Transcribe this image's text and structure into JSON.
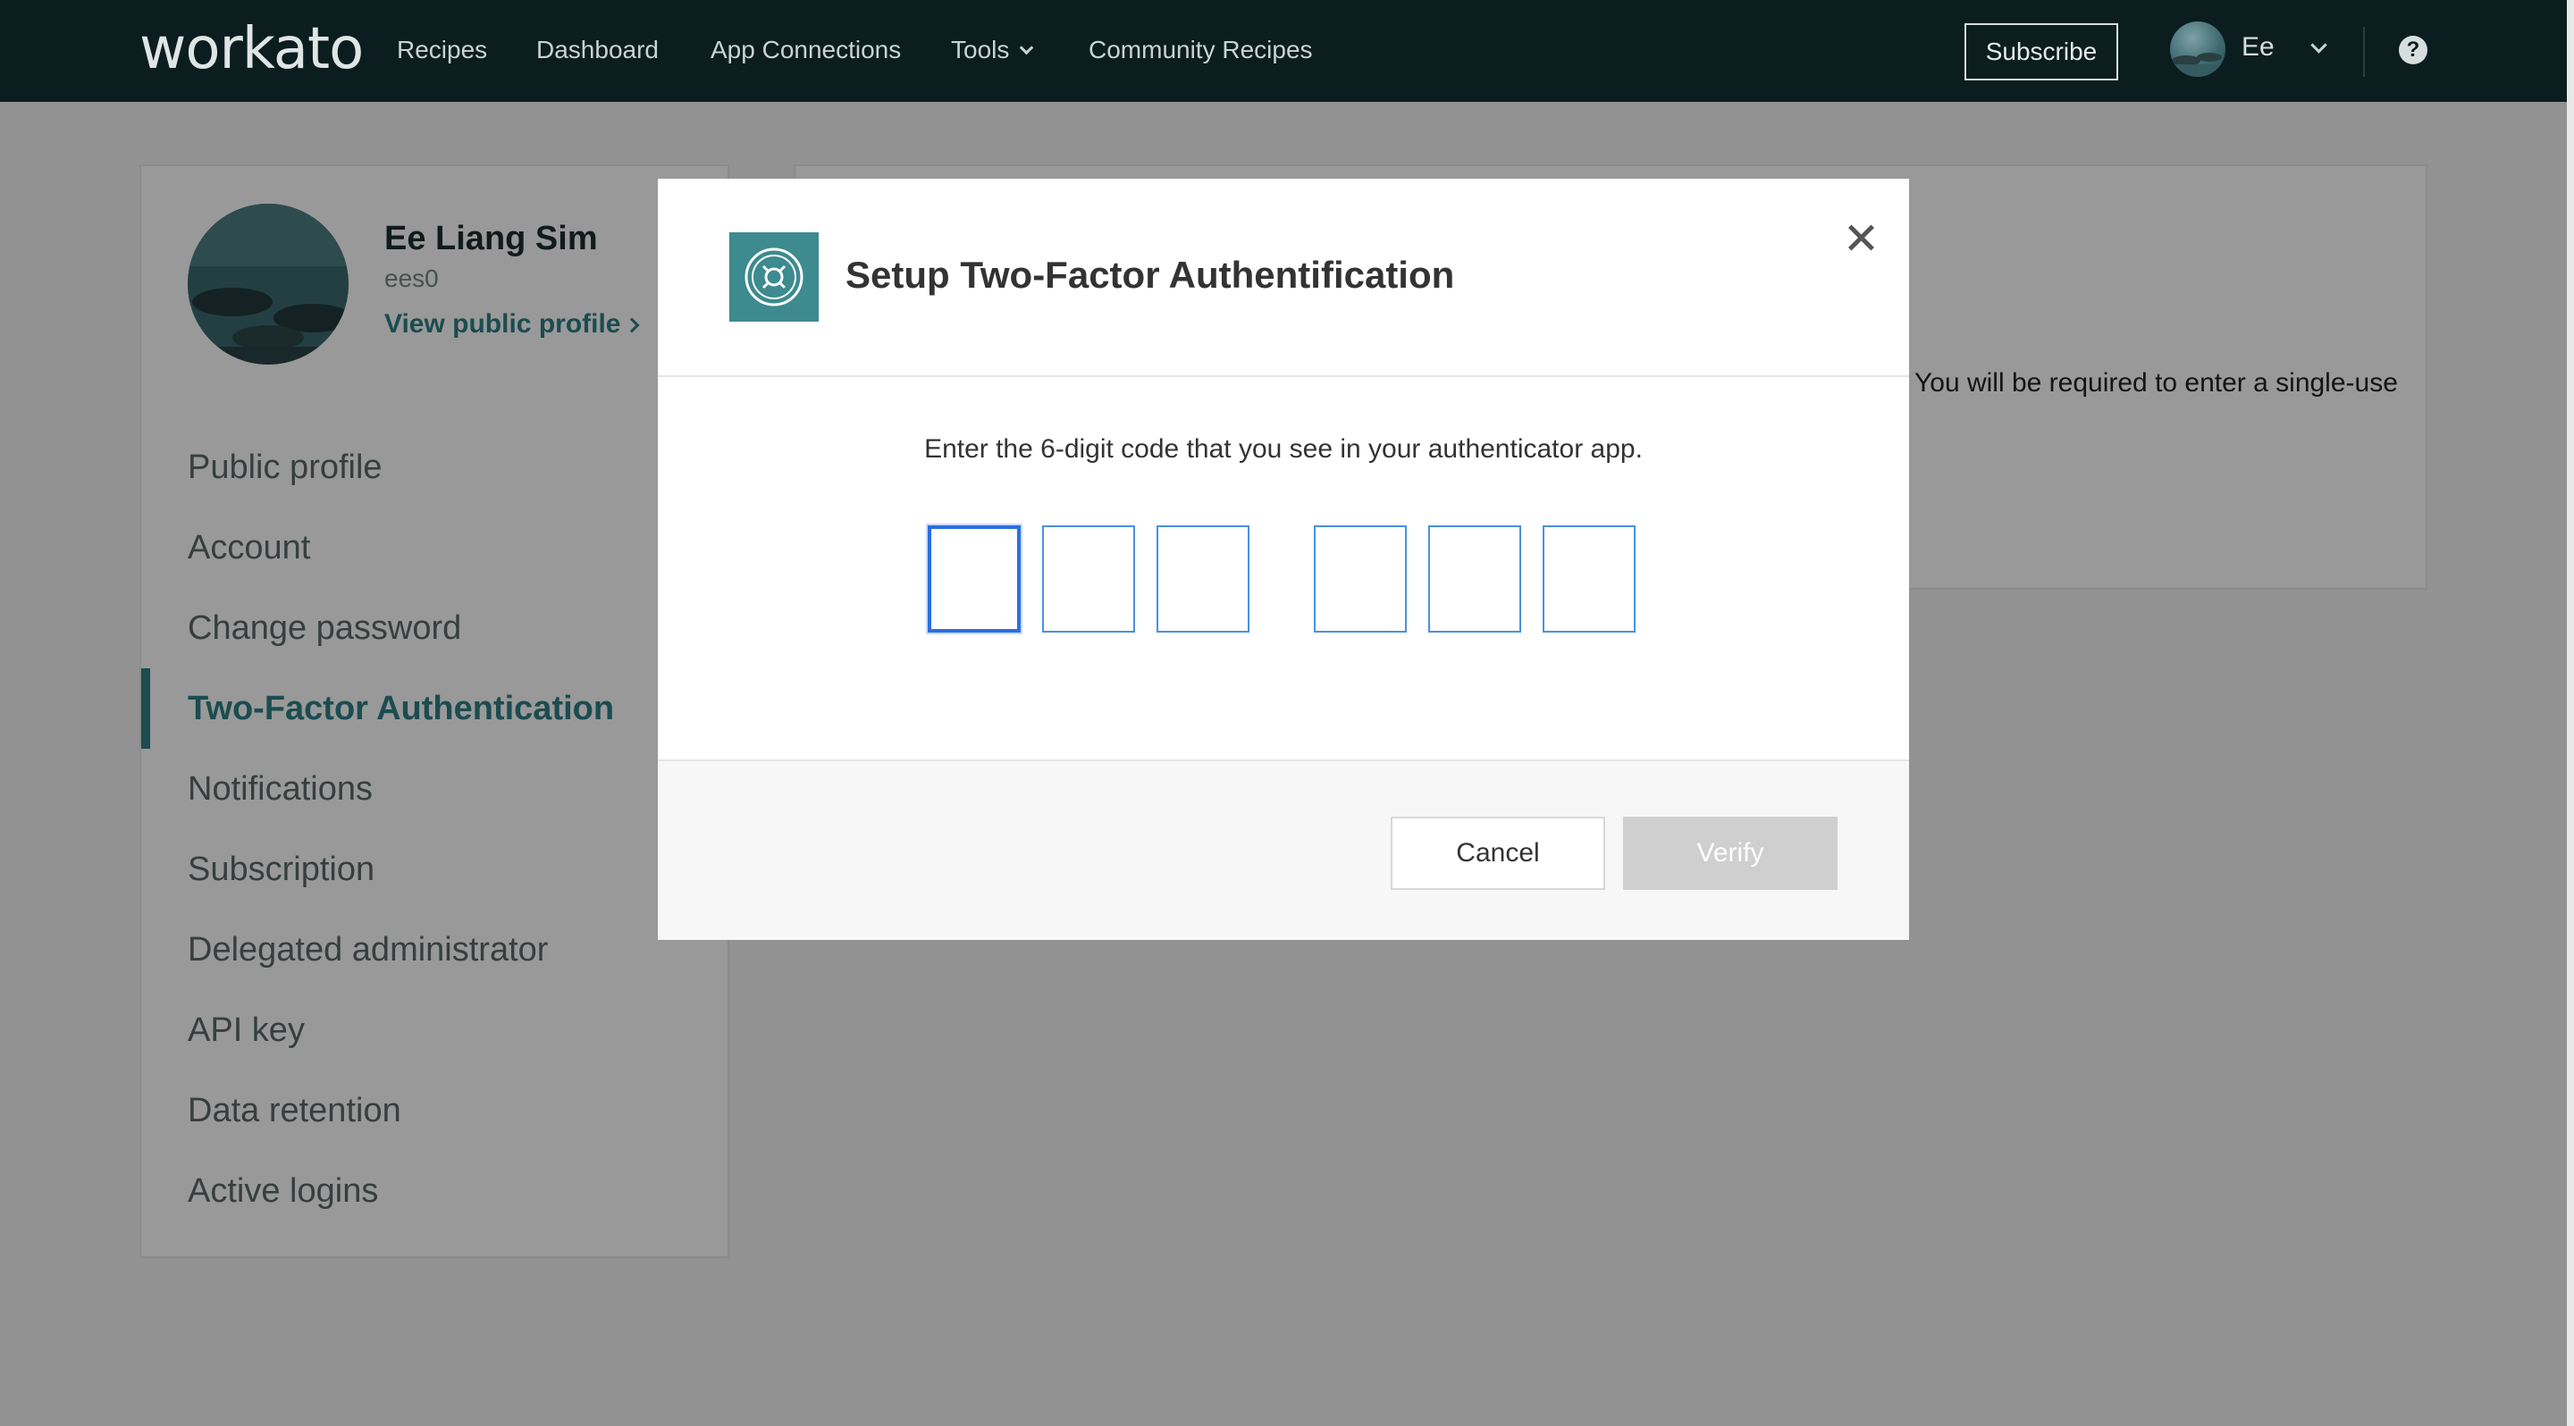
{
  "nav": {
    "brand": "workato",
    "links": [
      "Recipes",
      "Dashboard",
      "App Connections",
      "Tools",
      "Community Recipes"
    ],
    "subscribe": "Subscribe",
    "user_short": "Ee"
  },
  "profile": {
    "name": "Ee Liang Sim",
    "handle": "ees0",
    "view_link": "View public profile"
  },
  "menu": {
    "items": [
      "Public profile",
      "Account",
      "Change password",
      "Two-Factor Authentication",
      "Notifications",
      "Subscription",
      "Delegated administrator",
      "API key",
      "Data retention",
      "Active logins"
    ],
    "active": "Two-Factor Authentication"
  },
  "main": {
    "partial_text": "You will be required to enter a single-use"
  },
  "modal": {
    "title": "Setup Two-Factor Authentification",
    "instruction": "Enter the 6-digit code that you see in your authenticator app.",
    "digits": [
      "",
      "",
      "",
      "",
      "",
      ""
    ],
    "cancel_label": "Cancel",
    "verify_label": "Verify"
  },
  "colors": {
    "nav_bg": "#0c1d1f",
    "accent": "#2e7f85",
    "modal_icon_bg": "#3d8a8f",
    "input_border": "#4a90e2",
    "verify_disabled": "#cfcfcf"
  },
  "icons": [
    "safe-icon",
    "close-icon",
    "chevron-down-icon",
    "help-icon",
    "chevron-right-icon"
  ]
}
